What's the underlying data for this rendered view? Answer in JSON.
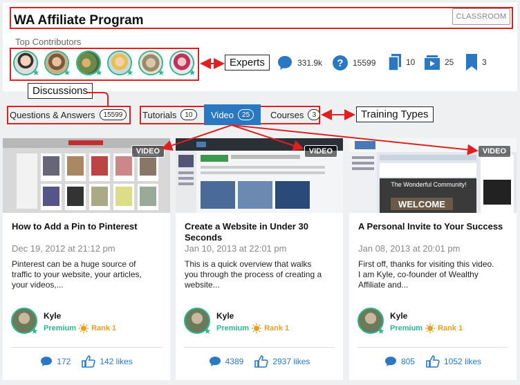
{
  "header": {
    "title": "WA Affiliate Program",
    "classroom_button": "CLASSROOM",
    "subtitle": "Top Contributors"
  },
  "stats": [
    {
      "icon": "chat-bubble-icon",
      "value": "331.9k"
    },
    {
      "icon": "question-icon",
      "value": "15599"
    },
    {
      "icon": "pages-icon",
      "value": "10"
    },
    {
      "icon": "video-folder-icon",
      "value": "25"
    },
    {
      "icon": "bookmark-icon",
      "value": "3"
    }
  ],
  "annotations": {
    "experts": "Experts",
    "discussions": "Discussions",
    "training_types": "Training Types"
  },
  "tabs": {
    "qa": {
      "label": "Questions & Answers",
      "count": "15599"
    },
    "tutorials": {
      "label": "Tutorials",
      "count": "10"
    },
    "video": {
      "label": "Video",
      "count": "25"
    },
    "courses": {
      "label": "Courses",
      "count": "3"
    }
  },
  "cards": [
    {
      "badge": "VIDEO",
      "title": "How to Add a Pin to Pinterest",
      "date": "Dec 19, 2012 at 21:12 pm",
      "excerpt": "Pinterest can be a huge source of traffic to your website, your articles, your videos,...",
      "author": "Kyle",
      "membership": "Premium",
      "rank": "Rank 1",
      "comments": "172",
      "likes": "142 likes"
    },
    {
      "badge": "VIDEO",
      "title": "Create a Website in Under 30 Seconds",
      "date": "Jan 10, 2013 at 22:01 pm",
      "excerpt": "This is a quick overview that walks you through the process of creating a website...",
      "author": "Kyle",
      "membership": "Premium",
      "rank": "Rank 1",
      "comments": "4389",
      "likes": "2937 likes"
    },
    {
      "badge": "VIDEO",
      "title": "A Personal Invite to Your Success",
      "date": "Jan 08, 2013 at 20:01 pm",
      "excerpt": "First off, thanks for visiting this video. I am Kyle, co-founder of Wealthy Affiliate and...",
      "author": "Kyle",
      "membership": "Premium",
      "rank": "Rank 1",
      "comments": "805",
      "likes": "1052 likes"
    }
  ],
  "thumb_text": {
    "card2_banner": "The Wonderful Community!",
    "card3_sign": "WELCOME"
  },
  "colors": {
    "accent_blue": "#2a77c2",
    "premium_green": "#2eb58f",
    "rank_orange": "#e6a020",
    "annotation_red": "#e02020"
  }
}
